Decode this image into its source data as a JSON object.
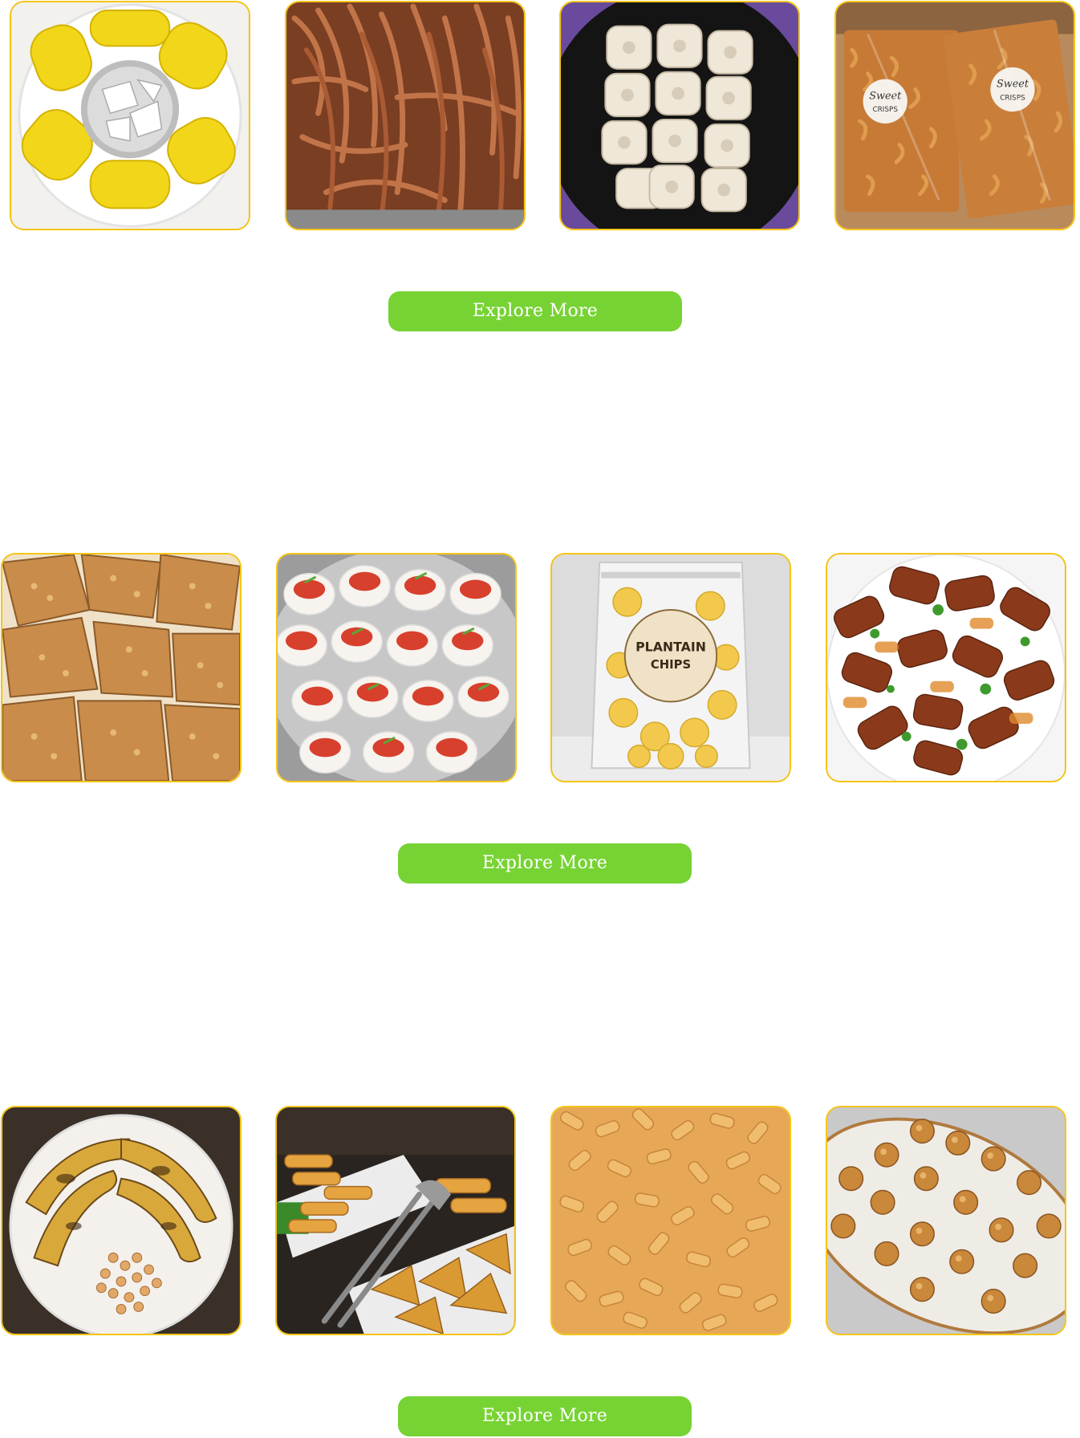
{
  "colors": {
    "tile_border": "#f5c518",
    "button_bg": "#77d334",
    "button_text": "#ffffff",
    "page_bg": "#ffffff"
  },
  "sections": [
    {
      "images": [
        {
          "icon": "corn-and-coconut-photo"
        },
        {
          "icon": "chin-chin-sticks-photo"
        },
        {
          "icon": "white-cookies-photo"
        },
        {
          "icon": "sweet-crisps-bags-photo",
          "label": "Sweet",
          "sublabel": "CRISPS"
        }
      ],
      "button_label": "Explore More"
    },
    {
      "images": [
        {
          "icon": "peanut-brittle-photo"
        },
        {
          "icon": "stuffed-eggs-photo"
        },
        {
          "icon": "plantain-chips-bag-photo",
          "label": "PLANTAIN",
          "sublabel": "CHIPS"
        },
        {
          "icon": "spicy-fried-plantain-photo"
        }
      ],
      "button_label": "Explore More"
    },
    {
      "images": [
        {
          "icon": "roasted-plantain-and-peanuts-photo"
        },
        {
          "icon": "spring-rolls-and-samosas-photo"
        },
        {
          "icon": "chin-chin-pile-photo"
        },
        {
          "icon": "coconut-candy-balls-photo"
        }
      ],
      "button_label": "Explore More"
    }
  ]
}
